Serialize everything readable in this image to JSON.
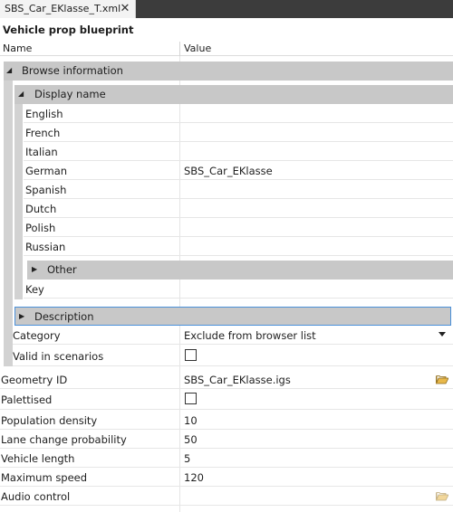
{
  "tab": {
    "label": "SBS_Car_EKlasse_T.xml",
    "close": "✕"
  },
  "panel": {
    "title": "Vehicle prop blueprint"
  },
  "columns": {
    "name": "Name",
    "value": "Value"
  },
  "browse_information": {
    "label": "Browse information",
    "display_name": {
      "label": "Display name",
      "languages": [
        {
          "name": "English",
          "value": ""
        },
        {
          "name": "French",
          "value": ""
        },
        {
          "name": "Italian",
          "value": ""
        },
        {
          "name": "German",
          "value": "SBS_Car_EKlasse"
        },
        {
          "name": "Spanish",
          "value": ""
        },
        {
          "name": "Dutch",
          "value": ""
        },
        {
          "name": "Polish",
          "value": ""
        },
        {
          "name": "Russian",
          "value": ""
        }
      ],
      "other_label": "Other",
      "key_label": "Key",
      "key_value": ""
    },
    "description_label": "Description",
    "category": {
      "name": "Category",
      "value": "Exclude from browser list"
    },
    "valid_in_scenarios": {
      "name": "Valid in scenarios",
      "checked": false
    }
  },
  "properties": {
    "geometry_id": {
      "name": "Geometry ID",
      "value": "SBS_Car_EKlasse.igs"
    },
    "palettised": {
      "name": "Palettised",
      "checked": false
    },
    "population_density": {
      "name": "Population density",
      "value": "10"
    },
    "lane_change_probability": {
      "name": "Lane change probability",
      "value": "50"
    },
    "vehicle_length": {
      "name": "Vehicle length",
      "value": "5"
    },
    "maximum_speed": {
      "name": "Maximum speed",
      "value": "120"
    },
    "audio_control": {
      "name": "Audio control",
      "value": ""
    }
  },
  "icons": {
    "expanded": "expanded-triangle-icon",
    "collapsed": "collapsed-triangle-icon",
    "folder": "folder-open-icon",
    "dropdown": "dropdown-arrow-icon",
    "close": "close-icon"
  },
  "colors": {
    "tabstrip": "#3c3c3c",
    "group_header": "#c8c8c8",
    "indent_bar": "#d2d2d2",
    "selection_border": "#4a90d9",
    "folder": "#e8b84a"
  }
}
